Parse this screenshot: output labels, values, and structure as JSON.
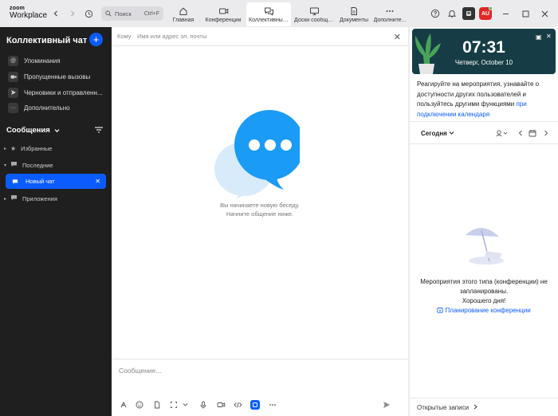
{
  "app": {
    "brand_line1": "zoom",
    "brand_line2": "Workplace"
  },
  "search": {
    "label": "Поиск",
    "shortcut": "Ctrl+F"
  },
  "tabs": [
    {
      "label": "Главная",
      "icon": "home-icon"
    },
    {
      "label": "Конференции",
      "icon": "video-icon"
    },
    {
      "label": "Коллективный ...",
      "icon": "chat-icon",
      "active": true
    },
    {
      "label": "Доски сообще...",
      "icon": "whiteboard-icon"
    },
    {
      "label": "Документы",
      "icon": "document-icon"
    },
    {
      "label": "Дополните...",
      "icon": "more-icon"
    }
  ],
  "avatar": {
    "initials": "AU",
    "color": "#e02828",
    "status_color": "#29c24a"
  },
  "sidebar": {
    "title": "Коллективный чат",
    "items": [
      {
        "label": "Упоминания",
        "icon": "at-icon"
      },
      {
        "label": "Пропущенные вызовы",
        "icon": "missed-call-icon"
      },
      {
        "label": "Черновики и отправленн...",
        "icon": "send-icon"
      },
      {
        "label": "Дополнительно",
        "icon": "more-icon"
      }
    ],
    "section_title": "Сообщения",
    "groups": [
      {
        "label": "Избранные",
        "icon": "star-icon"
      },
      {
        "label": "Последние",
        "icon": "chat-bubble-icon"
      }
    ],
    "active_chat": "Новый чат",
    "apps_label": "Приложения"
  },
  "chat": {
    "to_label": "Кому",
    "to_placeholder": "Имя или адрес эл. почты",
    "empty_line1": "Вы начинаете новую беседу.",
    "empty_line2": "Начните общение ниже.",
    "message_placeholder": "Сообщение..."
  },
  "right": {
    "time": "07:31",
    "date": "Четверг, October 10",
    "promo_text": "Реагируйте на мероприятия, узнавайте о доступности других пользователей и пользуйтесь другими функциями ",
    "promo_link": "при подключении календаря",
    "today_label": "Сегодня",
    "empty_line1": "Мероприятия этого типа (конференции) не",
    "empty_line2": "запланированы.",
    "empty_line3": "Хорошего дня!",
    "schedule_link": "Планирование конференции",
    "notes_label": "Открытые записи"
  },
  "colors": {
    "accent": "#0b5cff",
    "sidebar_bg": "#1f1f1f",
    "banner_bg": "#163d45",
    "bubble": "#1a9bf5"
  }
}
